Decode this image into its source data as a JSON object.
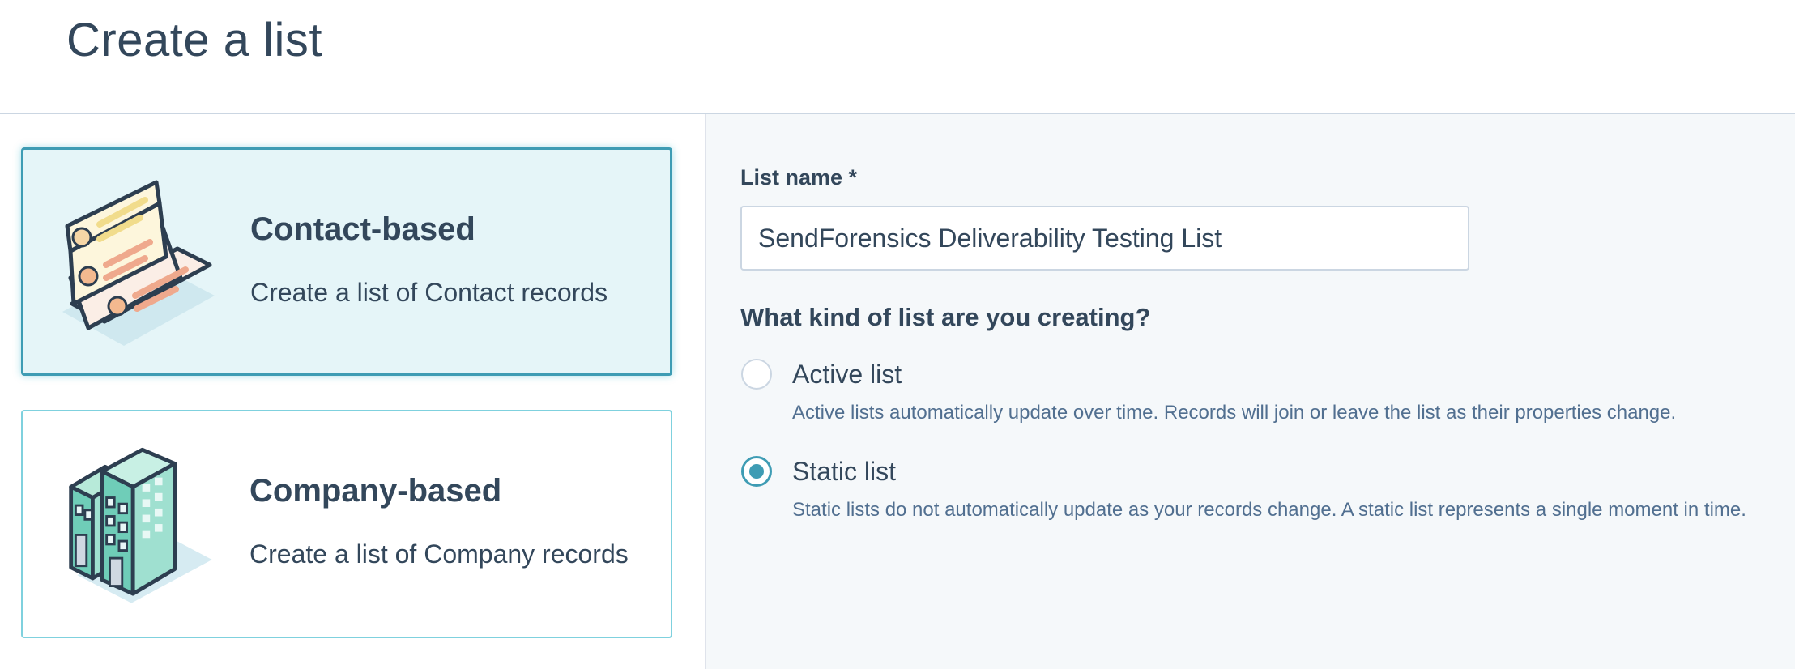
{
  "header": {
    "title": "Create a list"
  },
  "object_types": [
    {
      "title": "Contact-based",
      "description": "Create a list of Contact records",
      "icon": "contact-cards-icon",
      "selected": true
    },
    {
      "title": "Company-based",
      "description": "Create a list of Company records",
      "icon": "buildings-icon",
      "selected": false
    }
  ],
  "form": {
    "list_name_label": "List name *",
    "list_name_value": "SendForensics Deliverability Testing List",
    "list_type_question": "What kind of list are you creating?",
    "list_types": [
      {
        "label": "Active list",
        "help": "Active lists automatically update over time. Records will join or leave the list as their properties change.",
        "checked": false
      },
      {
        "label": "Static list",
        "help": "Static lists do not automatically update as your records change. A static list represents a single moment in time.",
        "checked": true
      }
    ]
  },
  "colors": {
    "text": "#33475b",
    "selected_border": "#3e9cb4",
    "selected_bg": "#e5f5f8",
    "card_border": "#7fd1de",
    "panel_bg": "#f5f8fa",
    "help_text": "#516f90"
  }
}
